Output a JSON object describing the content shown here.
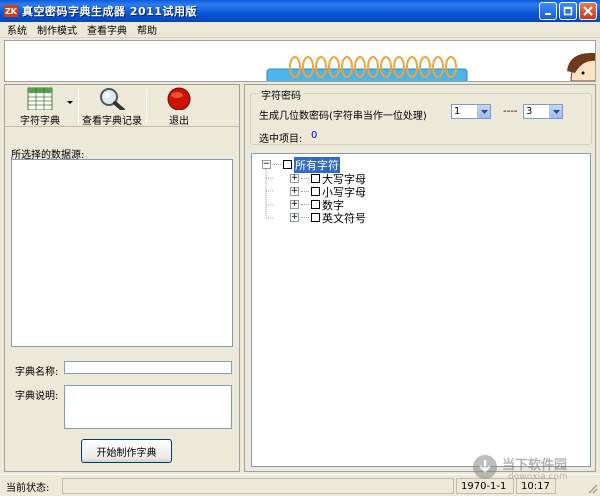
{
  "window": {
    "title": "真空密码字典生成器 2011试用版",
    "icon_text": "ZK",
    "controls": [
      "minimize-icon",
      "maximize-icon",
      "close-icon"
    ]
  },
  "menu": [
    "系统",
    "制作模式",
    "查看字典",
    "帮助"
  ],
  "toolbar": {
    "dict_label": "字符字典",
    "view_label": "查看字典记录",
    "exit_label": "退出"
  },
  "left": {
    "source_label": "所选择的数据源:",
    "name_label": "字典名称:",
    "name_value": "",
    "desc_label": "字典说明:",
    "desc_value": "",
    "start_button": "开始制作字典"
  },
  "right": {
    "group_title": "字符密码",
    "gen_label": "生成几位数密码(字符串当作一位处理)",
    "min_value": "1",
    "dash": "----",
    "max_value": "3",
    "selected_label": "选中项目:",
    "selected_count": "0"
  },
  "tree": {
    "root": "所有字符",
    "children": [
      "大写字母",
      "小写字母",
      "数字",
      "英文符号"
    ]
  },
  "status": {
    "label": "当前状态:",
    "value": "",
    "date": "1970-1-1",
    "time": "10:17"
  },
  "watermark": {
    "text": "当下软件园",
    "sub": "downxia.com"
  },
  "colors": {
    "titlebar": "#0a5be0",
    "selection": "#316ac5",
    "exit_red": "#cc1100"
  }
}
